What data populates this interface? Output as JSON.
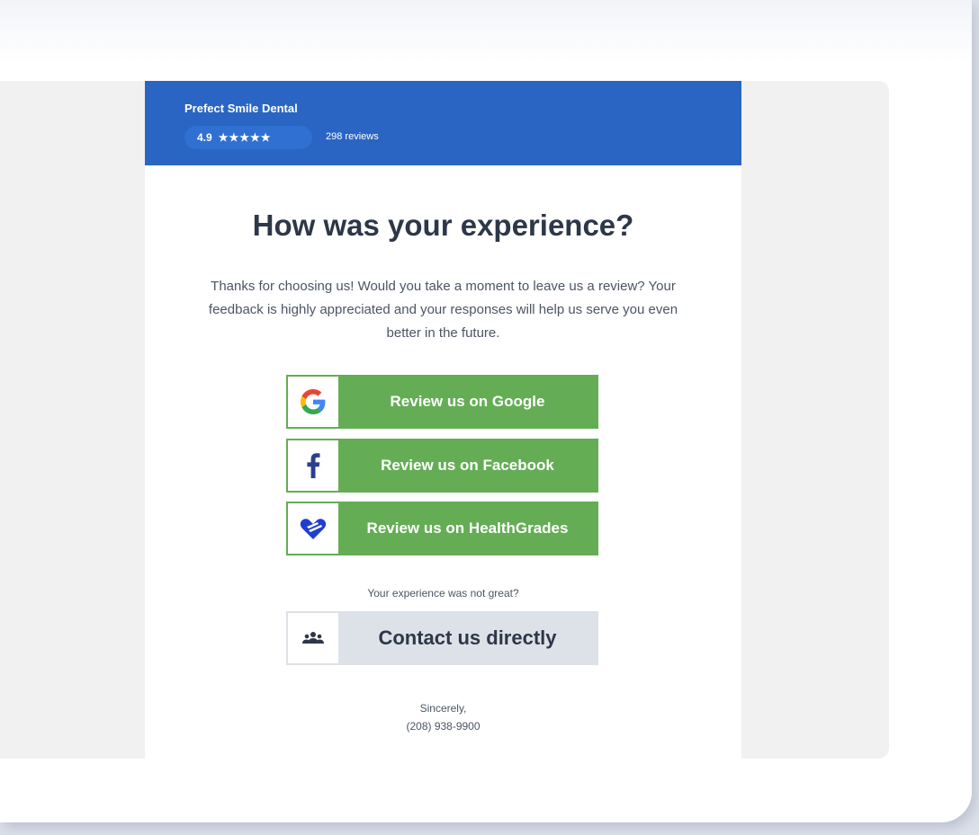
{
  "header": {
    "business_name": "Prefect Smile Dental",
    "rating": "4.9",
    "stars": "★★★★★",
    "review_count": "298 reviews"
  },
  "main": {
    "headline": "How was your experience?",
    "intro": "Thanks for choosing us! Would you take a moment to leave us a review? Your feedback is highly appreciated and your responses will help us serve you even better in the future.",
    "review_buttons": [
      {
        "label": "Review us on Google",
        "icon": "google-icon"
      },
      {
        "label": "Review us on Facebook",
        "icon": "facebook-icon"
      },
      {
        "label": "Review us on HealthGrades",
        "icon": "healthgrades-icon"
      }
    ],
    "not_great_text": "Your experience was not great?",
    "contact_button": {
      "label": "Contact us directly",
      "icon": "people-icon"
    },
    "signoff": "Sincerely,",
    "phone": "(208) 938-9900"
  },
  "colors": {
    "header_blue": "#2a65c3",
    "button_green": "#64ad55",
    "contact_gray": "#dde1e8",
    "heading_text": "#2d3748"
  }
}
